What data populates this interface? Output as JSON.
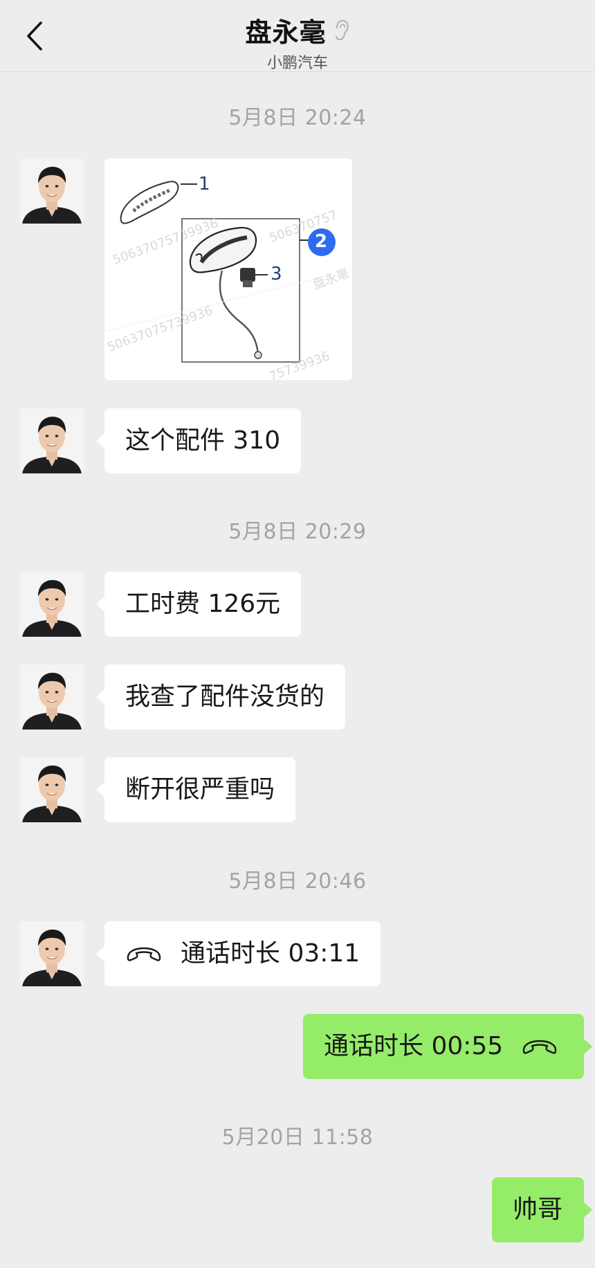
{
  "header": {
    "title": "盘永毫",
    "subtitle": "小鹏汽车"
  },
  "messages": [
    {
      "type": "time",
      "text": "5月8日 20:24"
    },
    {
      "type": "image",
      "side": "left",
      "labels": [
        "1",
        "2",
        "3"
      ],
      "watermarks": [
        "50637075739936",
        "盘永毫",
        "506370757",
        "75739936"
      ]
    },
    {
      "type": "text",
      "side": "left",
      "text": "这个配件 310"
    },
    {
      "type": "time",
      "text": "5月8日 20:29"
    },
    {
      "type": "text",
      "side": "left",
      "text": "工时费 126元"
    },
    {
      "type": "text",
      "side": "left",
      "text": "我查了配件没货的"
    },
    {
      "type": "text",
      "side": "left",
      "text": "断开很严重吗"
    },
    {
      "type": "time",
      "text": "5月8日 20:46"
    },
    {
      "type": "call",
      "side": "left",
      "text": "通话时长 03:11",
      "icon": "phone-hangup-icon"
    },
    {
      "type": "call",
      "side": "right",
      "text": "通话时长 00:55",
      "icon": "phone-hangup-icon"
    },
    {
      "type": "time",
      "text": "5月20日 11:58"
    },
    {
      "type": "text",
      "side": "right",
      "text": "帅哥"
    }
  ],
  "colors": {
    "background": "#ededed",
    "incoming_bubble": "#ffffff",
    "outgoing_bubble": "#95ec69",
    "timestamp": "#a3a3a3",
    "diagram_badge": "#2e6bf0"
  },
  "icons": {
    "back": "chevron-left-icon",
    "status": "ear-icon"
  }
}
